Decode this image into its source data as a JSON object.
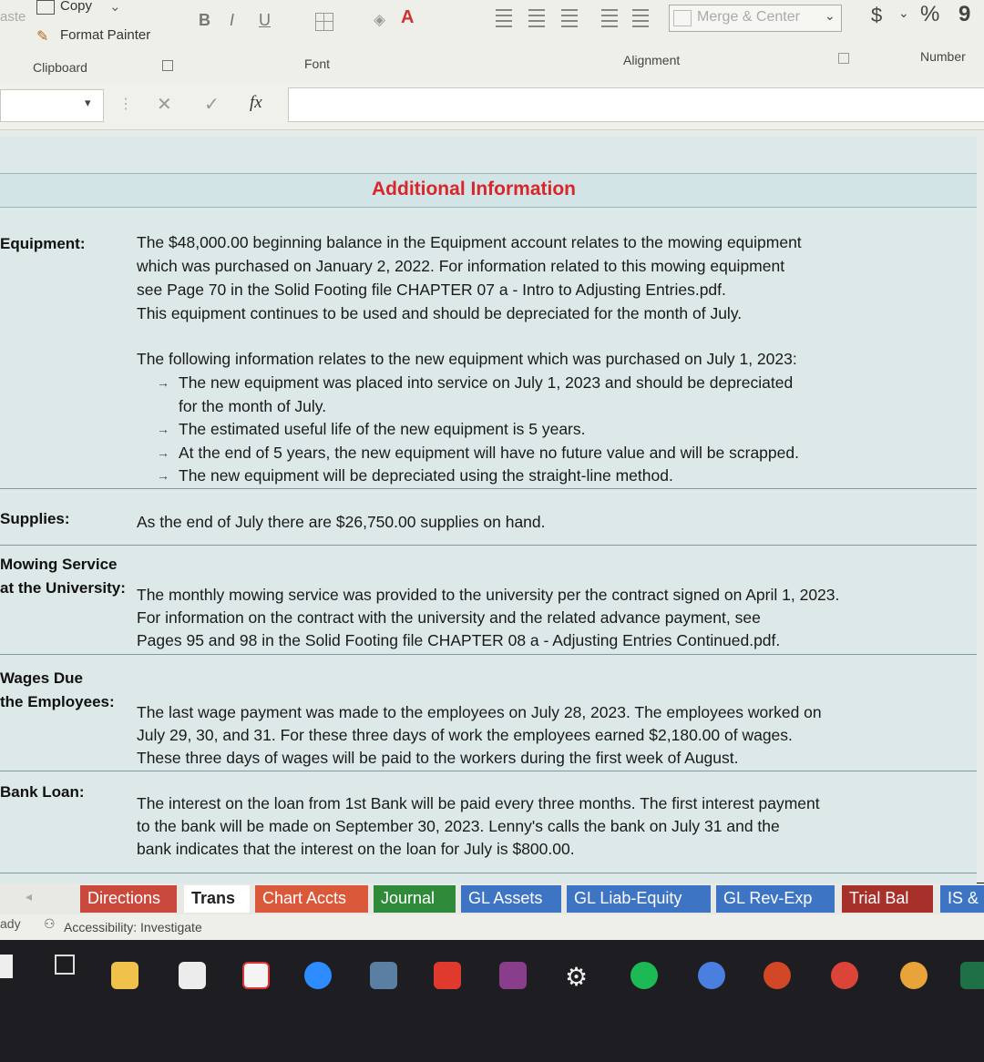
{
  "ribbon": {
    "paste_label": "aste",
    "copy_label": "Copy",
    "format_painter_label": "Format Painter",
    "clipboard_group": "Clipboard",
    "font_group": "Font",
    "alignment_group": "Alignment",
    "number_group": "Number",
    "bold": "B",
    "italic": "I",
    "underline": "U",
    "merge_center_label": "Merge & Center",
    "currency": "$",
    "percent": "%",
    "comma": "9"
  },
  "formula_bar": {
    "cancel": "✕",
    "enter": "✓",
    "fx": "fx"
  },
  "sheet": {
    "title": "Additional Information",
    "equipment": {
      "label": "Equipment:",
      "lines": [
        "The $48,000.00 beginning balance in the Equipment account relates to the mowing equipment",
        "which was purchased on January 2, 2022.  For information related to this mowing equipment",
        "see Page 70 in the Solid Footing file CHAPTER 07 a - Intro to Adjusting Entries.pdf.",
        "This equipment continues to be used and should be depreciated for the month of July."
      ],
      "intro": "The following information relates to the new equipment which was purchased on July 1, 2023:",
      "bullets": [
        "The new equipment was placed into service on July 1, 2023 and should be depreciated",
        "for the month of July.",
        "The estimated useful life of the new equipment is 5 years.",
        "At the end of 5 years, the new equipment will have no future value and will be scrapped.",
        "The new equipment will be depreciated using the straight-line method."
      ]
    },
    "supplies": {
      "label": "Supplies:",
      "text": "As the end of July there are $26,750.00 supplies on hand."
    },
    "mowing": {
      "label1": "Mowing Service",
      "label2": "at the University:",
      "lines": [
        "The monthly mowing service was provided to the university per the contract signed on April 1, 2023.",
        "For information on the contract with the university and the related advance payment, see",
        "Pages 95 and 98 in the Solid Footing file CHAPTER 08 a - Adjusting Entries Continued.pdf."
      ]
    },
    "wages": {
      "label1": "Wages Due",
      "label2": "the Employees:",
      "lines": [
        "The last wage payment was made to the employees on July 28, 2023.  The employees worked on",
        "July 29, 30, and 31.  For these three days of work the employees earned $2,180.00 of wages.",
        "These three days of wages will be paid to the workers during the first week of August."
      ]
    },
    "loan": {
      "label": "Bank Loan:",
      "lines": [
        "The interest on the loan from 1st Bank will be paid every three months.  The first interest payment",
        "to the bank will be made on September 30, 2023.  Lenny's calls the bank on July 31 and the",
        "bank indicates that the interest on the loan for July is $800.00."
      ]
    }
  },
  "tabs": [
    {
      "label": "Directions",
      "color": "#c94a3c"
    },
    {
      "label": "Trans",
      "color": "#ffffff"
    },
    {
      "label": "Chart Accts",
      "color": "#d9593a"
    },
    {
      "label": "Journal",
      "color": "#2f8a3a"
    },
    {
      "label": "GL Assets",
      "color": "#3d74c4"
    },
    {
      "label": "GL Liab-Equity",
      "color": "#3d74c4"
    },
    {
      "label": "GL Rev-Exp",
      "color": "#3d74c4"
    },
    {
      "label": "Trial Bal",
      "color": "#a8302a"
    },
    {
      "label": "IS &",
      "color": "#3d74c4"
    }
  ],
  "status": {
    "ready": "ady",
    "accessibility": "Accessibility: Investigate"
  },
  "taskbar_icons": [
    "windows-icon",
    "task-view-icon",
    "file-explorer-icon",
    "notepad-icon",
    "refresh-app-icon",
    "zoom-icon",
    "camera-icon",
    "red-app-icon",
    "winrar-icon",
    "settings-icon",
    "spotify-icon",
    "chrome-icon",
    "powerpoint-icon",
    "chrome-icon-2",
    "chrome-icon-3",
    "excel-icon"
  ]
}
